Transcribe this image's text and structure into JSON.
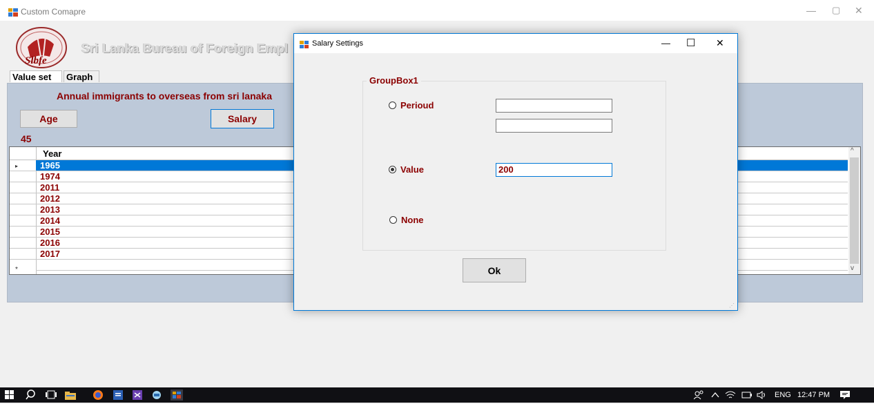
{
  "main_window": {
    "title": "Custom Comapre",
    "controls": {
      "minimize": "—",
      "maximize": "▢",
      "close": "✕"
    }
  },
  "banner": {
    "text": "Sri Lanka Bureau of Foreign Empl",
    "logo_text": "Slbfe"
  },
  "tabs": [
    {
      "label": "Value set"
    },
    {
      "label": "Graph"
    }
  ],
  "panel": {
    "heading": "Annual immigrants to overseas from sri lanaka",
    "age_button": "Age",
    "salary_button": "Salary",
    "count": "45"
  },
  "grid": {
    "column_header": "Year",
    "rows": [
      "1965",
      "1974",
      "2011",
      "2012",
      "2013",
      "2014",
      "2015",
      "2016",
      "2017"
    ],
    "selected_row": "1965",
    "row_marker": "▸",
    "new_row_marker": "*",
    "scroll_up": "^",
    "scroll_down": "v"
  },
  "dialog": {
    "title": "Salary Settings",
    "controls": {
      "minimize": "—",
      "maximize": "☐",
      "close": "✕"
    },
    "groupbox_label": "GroupBox1",
    "radios": [
      {
        "label": "Perioud",
        "checked": false
      },
      {
        "label": "Value",
        "checked": true
      },
      {
        "label": "None",
        "checked": false
      }
    ],
    "inputs": {
      "period_from": "",
      "period_to": "",
      "value": "200"
    },
    "ok_button": "Ok",
    "resize_grip": "⋰"
  },
  "taskbar": {
    "tray": "ENG",
    "time": "12:47 PM"
  },
  "colors": {
    "accent": "#0078d7",
    "label_text": "#8b0000",
    "panel_bg": "#bdc9d9",
    "taskbar_bg": "#101014"
  }
}
